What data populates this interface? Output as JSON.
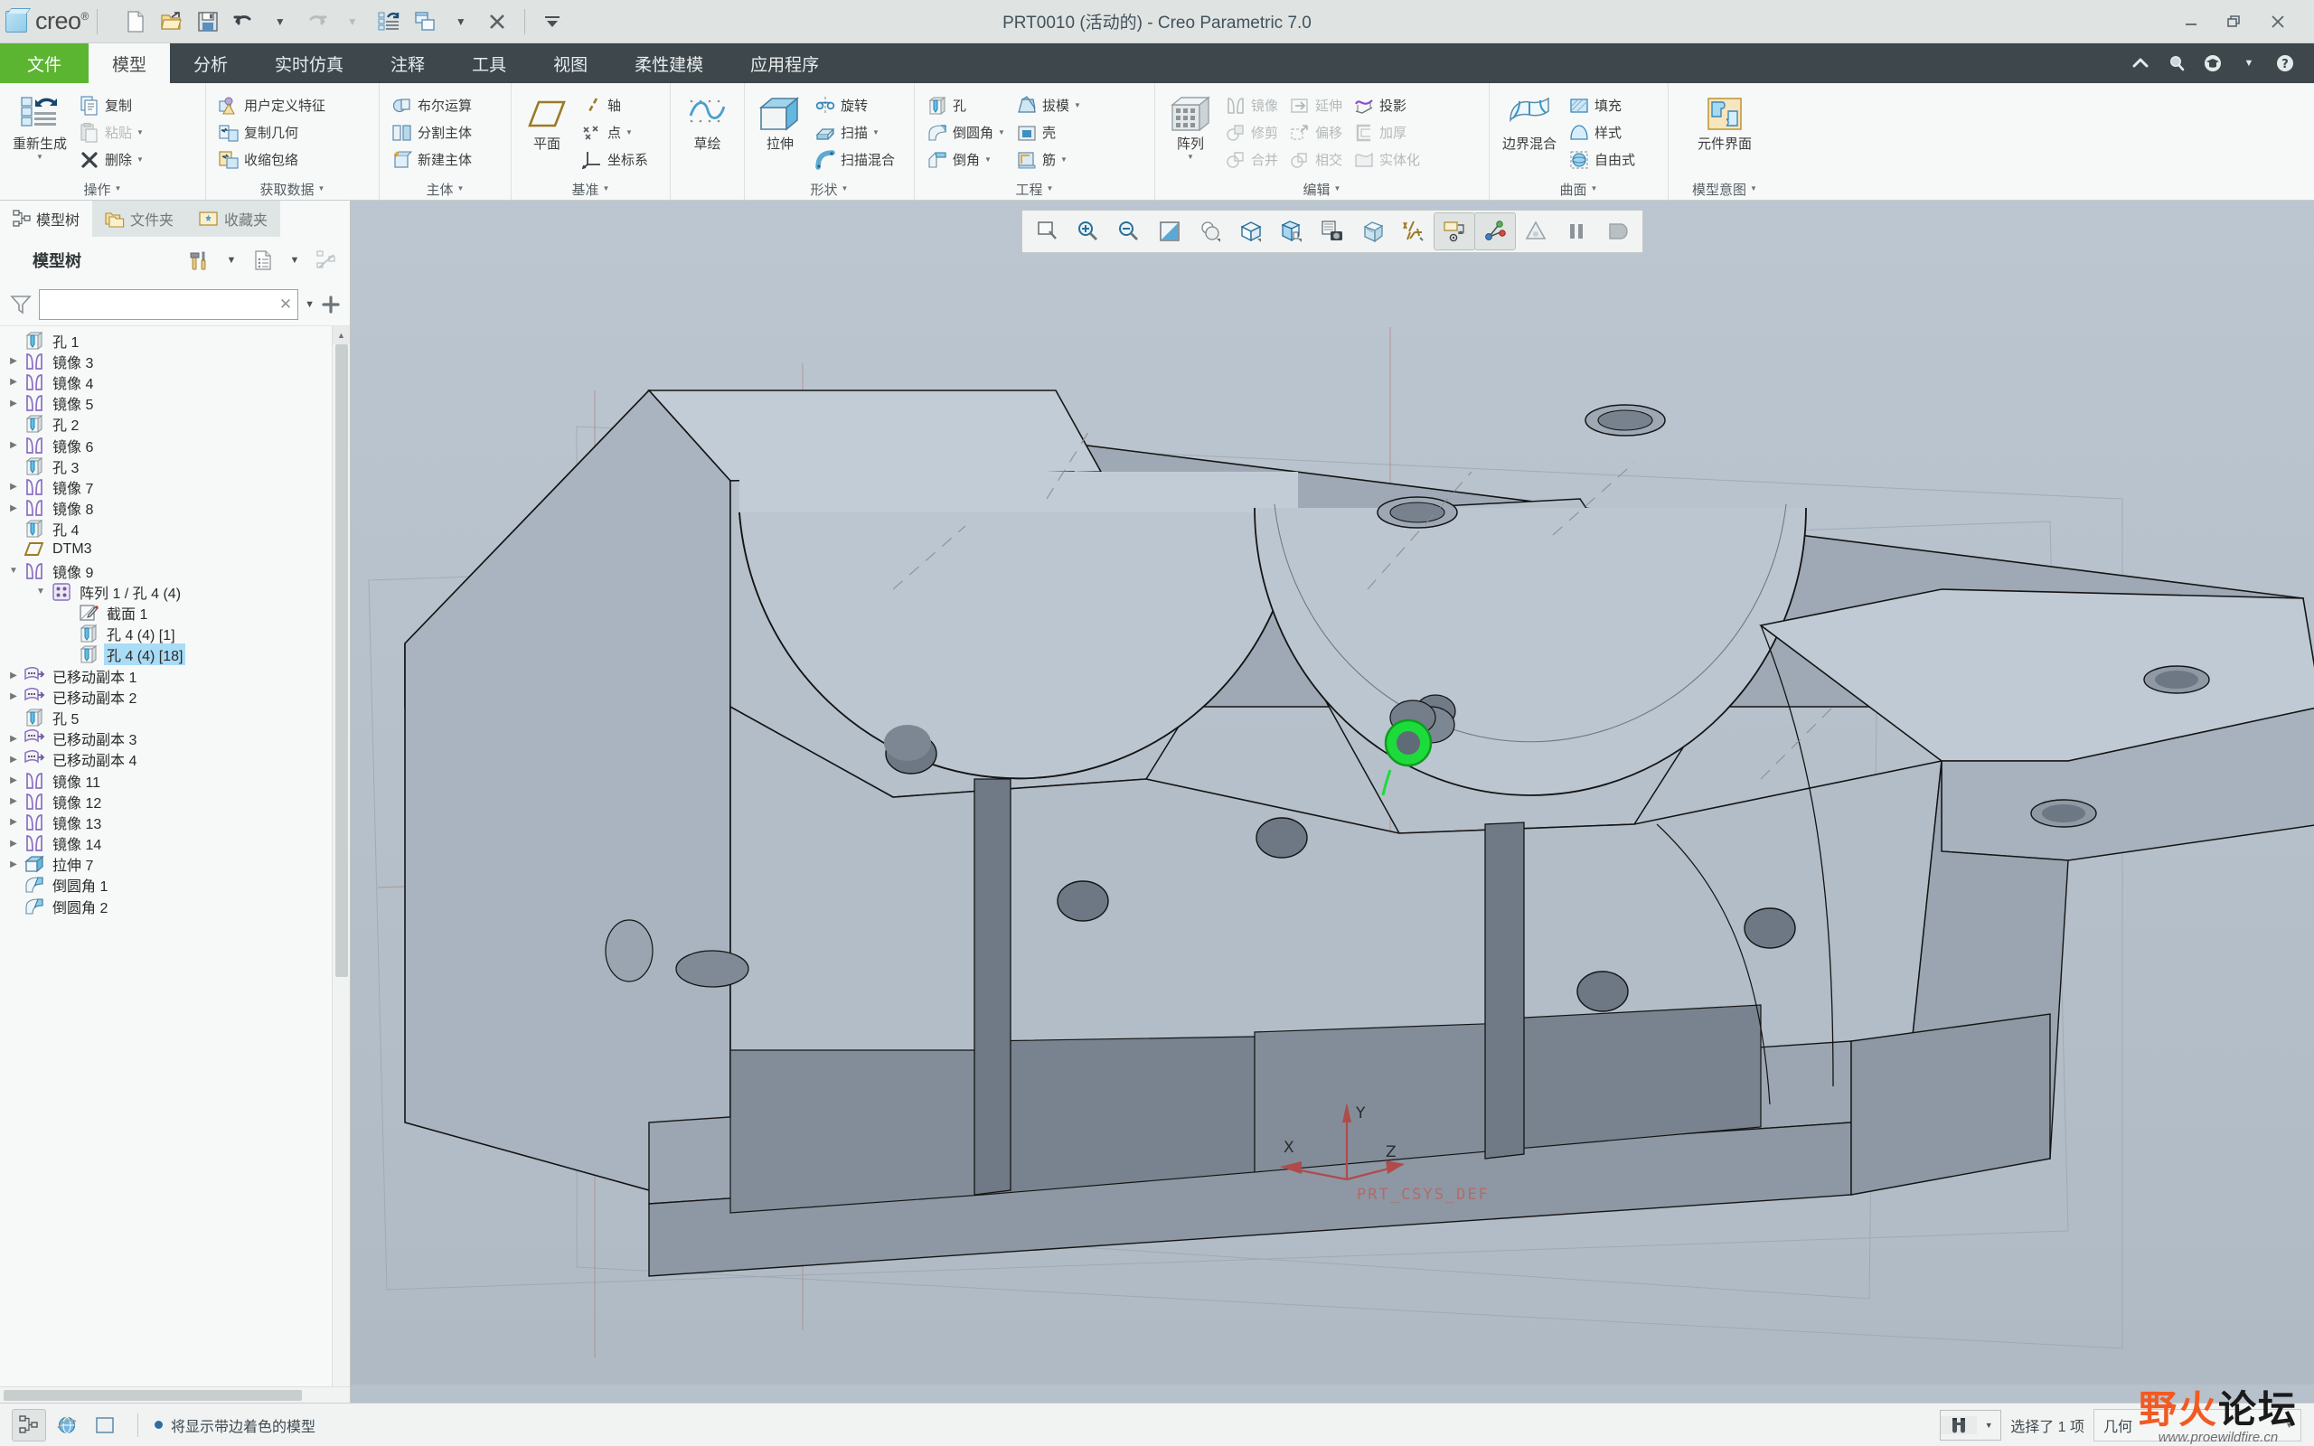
{
  "window": {
    "title": "PRT0010 (活动的) - Creo Parametric 7.0",
    "minimize": "—",
    "maximize": "❐",
    "close": "✕"
  },
  "quick_access": [
    {
      "name": "new-file",
      "icon": "new-document-icon"
    },
    {
      "name": "open-file",
      "icon": "open-folder-icon"
    },
    {
      "name": "save-file",
      "icon": "save-disk-icon"
    },
    {
      "name": "undo",
      "icon": "undo-arrow-icon"
    },
    {
      "name": "undo-dropdown",
      "icon": "chevron-down-icon"
    },
    {
      "name": "redo",
      "icon": "redo-arrow-icon"
    },
    {
      "name": "redo-dropdown",
      "icon": "chevron-down-icon"
    },
    {
      "name": "regenerate",
      "icon": "regenerate-icon"
    },
    {
      "name": "window-switch",
      "icon": "windows-icon"
    },
    {
      "name": "window-dropdown",
      "icon": "chevron-down-icon"
    },
    {
      "name": "close-window",
      "icon": "close-x-icon"
    },
    {
      "name": "customize-qat",
      "icon": "chevron-down-bar-icon"
    }
  ],
  "brand": {
    "word": "creo",
    "mark": "®"
  },
  "tabs": [
    {
      "label": "文件",
      "kind": "file"
    },
    {
      "label": "模型",
      "kind": "active"
    },
    {
      "label": "分析",
      "kind": "normal"
    },
    {
      "label": "实时仿真",
      "kind": "normal"
    },
    {
      "label": "注释",
      "kind": "normal"
    },
    {
      "label": "工具",
      "kind": "normal"
    },
    {
      "label": "视图",
      "kind": "normal"
    },
    {
      "label": "柔性建模",
      "kind": "normal"
    },
    {
      "label": "应用程序",
      "kind": "normal"
    }
  ],
  "tab_right_buttons": [
    {
      "name": "collapse-ribbon",
      "glyph": "⌃"
    },
    {
      "name": "search-icon",
      "glyph": "🔍"
    },
    {
      "name": "learning-icon",
      "glyph": "🎓"
    },
    {
      "name": "help-dropdown-icon",
      "glyph": "▾"
    },
    {
      "name": "help-icon",
      "glyph": "?"
    }
  ],
  "ribbon": {
    "groups": [
      {
        "title": "操作",
        "big": [
          {
            "label": "重新生成",
            "icon": "regenerate-icon",
            "dropdown": true
          }
        ],
        "small": [
          {
            "label": "复制",
            "icon": "copy-icon",
            "disabled": false,
            "dropdown": false
          },
          {
            "label": "粘贴",
            "icon": "paste-icon",
            "disabled": true,
            "dropdown": true
          },
          {
            "label": "删除",
            "icon": "delete-x-icon",
            "disabled": false,
            "dropdown": true
          }
        ]
      },
      {
        "title": "获取数据",
        "big": [],
        "small": [
          {
            "label": "用户定义特征",
            "icon": "udf-icon",
            "disabled": false,
            "dropdown": false
          },
          {
            "label": "复制几何",
            "icon": "copy-geometry-icon",
            "disabled": false,
            "dropdown": false
          },
          {
            "label": "收缩包络",
            "icon": "shrinkwrap-icon",
            "disabled": false,
            "dropdown": false
          }
        ]
      },
      {
        "title": "主体",
        "big": [],
        "small": [
          {
            "label": "布尔运算",
            "icon": "boolean-icon",
            "disabled": false,
            "dropdown": false
          },
          {
            "label": "分割主体",
            "icon": "split-body-icon",
            "disabled": false,
            "dropdown": false
          },
          {
            "label": "新建主体",
            "icon": "new-body-icon",
            "disabled": false,
            "dropdown": false
          }
        ]
      },
      {
        "title": "基准",
        "big": [
          {
            "label": "平面",
            "icon": "datum-plane-icon",
            "dropdown": false
          }
        ],
        "small": [
          {
            "label": "轴",
            "icon": "datum-axis-icon",
            "disabled": false,
            "dropdown": false
          },
          {
            "label": "点",
            "icon": "datum-point-icon",
            "disabled": false,
            "dropdown": true
          },
          {
            "label": "坐标系",
            "icon": "csys-icon",
            "disabled": false,
            "dropdown": false
          }
        ]
      },
      {
        "title": "",
        "big": [
          {
            "label": "草绘",
            "icon": "sketch-icon",
            "dropdown": false
          }
        ],
        "small": []
      },
      {
        "title": "形状",
        "big": [
          {
            "label": "拉伸",
            "icon": "extrude-icon",
            "dropdown": false
          }
        ],
        "small": [
          {
            "label": "旋转",
            "icon": "revolve-icon",
            "disabled": false,
            "dropdown": false
          },
          {
            "label": "扫描",
            "icon": "sweep-icon",
            "disabled": false,
            "dropdown": true
          },
          {
            "label": "扫描混合",
            "icon": "swept-blend-icon",
            "disabled": false,
            "dropdown": false
          }
        ]
      },
      {
        "title": "工程",
        "big": [],
        "small": [
          {
            "label": "孔",
            "icon": "hole-icon",
            "disabled": false,
            "dropdown": false
          },
          {
            "label": "倒圆角",
            "icon": "round-icon",
            "disabled": false,
            "dropdown": true
          },
          {
            "label": "倒角",
            "icon": "chamfer-icon",
            "disabled": false,
            "dropdown": true
          },
          {
            "label": "拔模",
            "icon": "draft-icon",
            "disabled": false,
            "dropdown": true
          },
          {
            "label": "壳",
            "icon": "shell-icon",
            "disabled": false,
            "dropdown": false
          },
          {
            "label": "筋",
            "icon": "rib-icon",
            "disabled": false,
            "dropdown": true
          }
        ]
      },
      {
        "title": "编辑",
        "big": [
          {
            "label": "阵列",
            "icon": "pattern-icon",
            "dropdown": true
          }
        ],
        "small": [
          {
            "label": "镜像",
            "icon": "mirror-icon",
            "disabled": true,
            "dropdown": false
          },
          {
            "label": "修剪",
            "icon": "trim-icon",
            "disabled": true,
            "dropdown": false
          },
          {
            "label": "合并",
            "icon": "merge-icon",
            "disabled": true,
            "dropdown": false
          },
          {
            "label": "延伸",
            "icon": "extend-icon",
            "disabled": true,
            "dropdown": false
          },
          {
            "label": "偏移",
            "icon": "offset-icon",
            "disabled": true,
            "dropdown": false
          },
          {
            "label": "相交",
            "icon": "intersect-icon",
            "disabled": true,
            "dropdown": false
          },
          {
            "label": "投影",
            "icon": "project-icon",
            "disabled": false,
            "dropdown": false
          },
          {
            "label": "加厚",
            "icon": "thicken-icon",
            "disabled": true,
            "dropdown": false
          },
          {
            "label": "实体化",
            "icon": "solidify-icon",
            "disabled": true,
            "dropdown": false
          }
        ]
      },
      {
        "title": "曲面",
        "big": [
          {
            "label": "边界混合",
            "icon": "boundary-blend-icon",
            "dropdown": false
          }
        ],
        "small": [
          {
            "label": "填充",
            "icon": "fill-icon",
            "disabled": false,
            "dropdown": false
          },
          {
            "label": "样式",
            "icon": "style-icon",
            "disabled": false,
            "dropdown": false
          },
          {
            "label": "自由式",
            "icon": "freestyle-icon",
            "disabled": false,
            "dropdown": false
          }
        ]
      },
      {
        "title": "模型意图",
        "big": [
          {
            "label": "元件界面",
            "icon": "component-interface-icon",
            "dropdown": false
          }
        ],
        "small": []
      }
    ]
  },
  "left_panel": {
    "nav_tabs": [
      {
        "label": "模型树",
        "icon": "model-tree-icon",
        "active": true
      },
      {
        "label": "文件夹",
        "icon": "folders-icon",
        "active": false
      },
      {
        "label": "收藏夹",
        "icon": "favorites-icon",
        "active": false
      }
    ],
    "panel_title": "模型树",
    "header_buttons": [
      {
        "name": "tools-settings-button",
        "icon": "hammer-screwdriver-icon",
        "dropdown": true
      },
      {
        "name": "display-settings-button",
        "icon": "list-document-icon",
        "dropdown": true
      },
      {
        "name": "tree-filter-toggle-button",
        "icon": "tree-hidden-icon",
        "dropdown": false
      }
    ],
    "filter": {
      "value": "",
      "placeholder": "",
      "clear": "✕"
    },
    "tree": [
      {
        "label": "孔 1",
        "icon": "hole-icon",
        "indent": 1,
        "arrow": "none",
        "selected": false
      },
      {
        "label": "镜像 3",
        "icon": "mirror-icon",
        "indent": 1,
        "arrow": "collapsed",
        "selected": false
      },
      {
        "label": "镜像 4",
        "icon": "mirror-icon",
        "indent": 1,
        "arrow": "collapsed",
        "selected": false
      },
      {
        "label": "镜像 5",
        "icon": "mirror-icon",
        "indent": 1,
        "arrow": "collapsed",
        "selected": false
      },
      {
        "label": "孔 2",
        "icon": "hole-icon",
        "indent": 1,
        "arrow": "none",
        "selected": false
      },
      {
        "label": "镜像 6",
        "icon": "mirror-icon",
        "indent": 1,
        "arrow": "collapsed",
        "selected": false
      },
      {
        "label": "孔 3",
        "icon": "hole-icon",
        "indent": 1,
        "arrow": "none",
        "selected": false
      },
      {
        "label": "镜像 7",
        "icon": "mirror-icon",
        "indent": 1,
        "arrow": "collapsed",
        "selected": false
      },
      {
        "label": "镜像 8",
        "icon": "mirror-icon",
        "indent": 1,
        "arrow": "collapsed",
        "selected": false
      },
      {
        "label": "孔 4",
        "icon": "hole-icon",
        "indent": 1,
        "arrow": "none",
        "selected": false
      },
      {
        "label": "DTM3",
        "icon": "datum-plane-icon",
        "indent": 1,
        "arrow": "none",
        "selected": false
      },
      {
        "label": "镜像 9",
        "icon": "mirror-icon",
        "indent": 1,
        "arrow": "expanded",
        "selected": false
      },
      {
        "label": "阵列 1 / 孔 4 (4)",
        "icon": "pattern-small-icon",
        "indent": 2,
        "arrow": "expanded",
        "selected": false
      },
      {
        "label": "截面 1",
        "icon": "section-sketch-icon",
        "indent": 3,
        "arrow": "none",
        "selected": false
      },
      {
        "label": "孔 4 (4) [1]",
        "icon": "hole-icon",
        "indent": 3,
        "arrow": "none",
        "selected": false
      },
      {
        "label": "孔 4 (4) [18]",
        "icon": "hole-icon",
        "indent": 3,
        "arrow": "none",
        "selected": true
      },
      {
        "label": "已移动副本 1",
        "icon": "moved-copy-icon",
        "indent": 1,
        "arrow": "collapsed",
        "selected": false
      },
      {
        "label": "已移动副本 2",
        "icon": "moved-copy-icon",
        "indent": 1,
        "arrow": "collapsed",
        "selected": false
      },
      {
        "label": "孔 5",
        "icon": "hole-icon",
        "indent": 1,
        "arrow": "none",
        "selected": false
      },
      {
        "label": "已移动副本 3",
        "icon": "moved-copy-icon",
        "indent": 1,
        "arrow": "collapsed",
        "selected": false
      },
      {
        "label": "已移动副本 4",
        "icon": "moved-copy-icon",
        "indent": 1,
        "arrow": "collapsed",
        "selected": false
      },
      {
        "label": "镜像 11",
        "icon": "mirror-icon",
        "indent": 1,
        "arrow": "collapsed",
        "selected": false
      },
      {
        "label": "镜像 12",
        "icon": "mirror-icon",
        "indent": 1,
        "arrow": "collapsed",
        "selected": false
      },
      {
        "label": "镜像 13",
        "icon": "mirror-icon",
        "indent": 1,
        "arrow": "collapsed",
        "selected": false
      },
      {
        "label": "镜像 14",
        "icon": "mirror-icon",
        "indent": 1,
        "arrow": "collapsed",
        "selected": false
      },
      {
        "label": "拉伸 7",
        "icon": "extrude-small-icon",
        "indent": 1,
        "arrow": "collapsed",
        "selected": false
      },
      {
        "label": "倒圆角 1",
        "icon": "round-icon",
        "indent": 1,
        "arrow": "none",
        "selected": false
      },
      {
        "label": "倒圆角 2",
        "icon": "round-icon",
        "indent": 1,
        "arrow": "none",
        "selected": false
      }
    ]
  },
  "graphics_toolbar": [
    {
      "name": "refit-icon",
      "pressed": false
    },
    {
      "name": "zoom-in-icon",
      "pressed": false
    },
    {
      "name": "zoom-out-icon",
      "pressed": false
    },
    {
      "name": "repaint-icon",
      "pressed": false
    },
    {
      "name": "display-style-icon",
      "pressed": false
    },
    {
      "name": "saved-orientations-icon",
      "pressed": false
    },
    {
      "name": "view-manager-icon",
      "pressed": false
    },
    {
      "name": "scene-camera-icon",
      "pressed": false
    },
    {
      "name": "perspective-view-icon",
      "pressed": false
    },
    {
      "name": "datum-display-filters-icon",
      "pressed": false
    },
    {
      "name": "annotation-display-icon",
      "pressed": true
    },
    {
      "name": "spin-center-icon",
      "pressed": true
    },
    {
      "name": "appearance-gallery-icon",
      "pressed": false
    },
    {
      "name": "pause-icon",
      "pressed": false
    },
    {
      "name": "stop-icon",
      "pressed": false
    }
  ],
  "viewport": {
    "csys_label": "PRT_CSYS_DEF",
    "axis_x": "X",
    "axis_y": "Y",
    "axis_z": "Z"
  },
  "statusbar": {
    "left_buttons": [
      {
        "name": "model-tree-toggle-button",
        "icon": "model-tree-icon",
        "on": true
      },
      {
        "name": "browser-toggle-button",
        "icon": "globe-icon",
        "on": false
      },
      {
        "name": "graphics-window-button",
        "icon": "window-square-icon",
        "on": false
      }
    ],
    "message": "将显示带边着色的模型",
    "selection_text": "选择了 1 项",
    "filter_value": "几何",
    "search_icon": "binoculars-icon"
  },
  "watermark": {
    "line1_a": "野",
    "line1_b": "火",
    "line1_c": "论坛",
    "url": "www.proewildfire.cn",
    "color_orange": "#f15a22",
    "color_dark": "#1a1a1a"
  },
  "colors": {
    "accent_green": "#5cb531",
    "tabbar_dark": "#3d474c",
    "ribbon_bg": "#f7f9f9",
    "viewport_bg": "#b7c1cb",
    "selection_blue": "#a9dcf5",
    "model_light": "#b9c3cd",
    "model_mid": "#97a2ae",
    "model_dark": "#78838f"
  }
}
